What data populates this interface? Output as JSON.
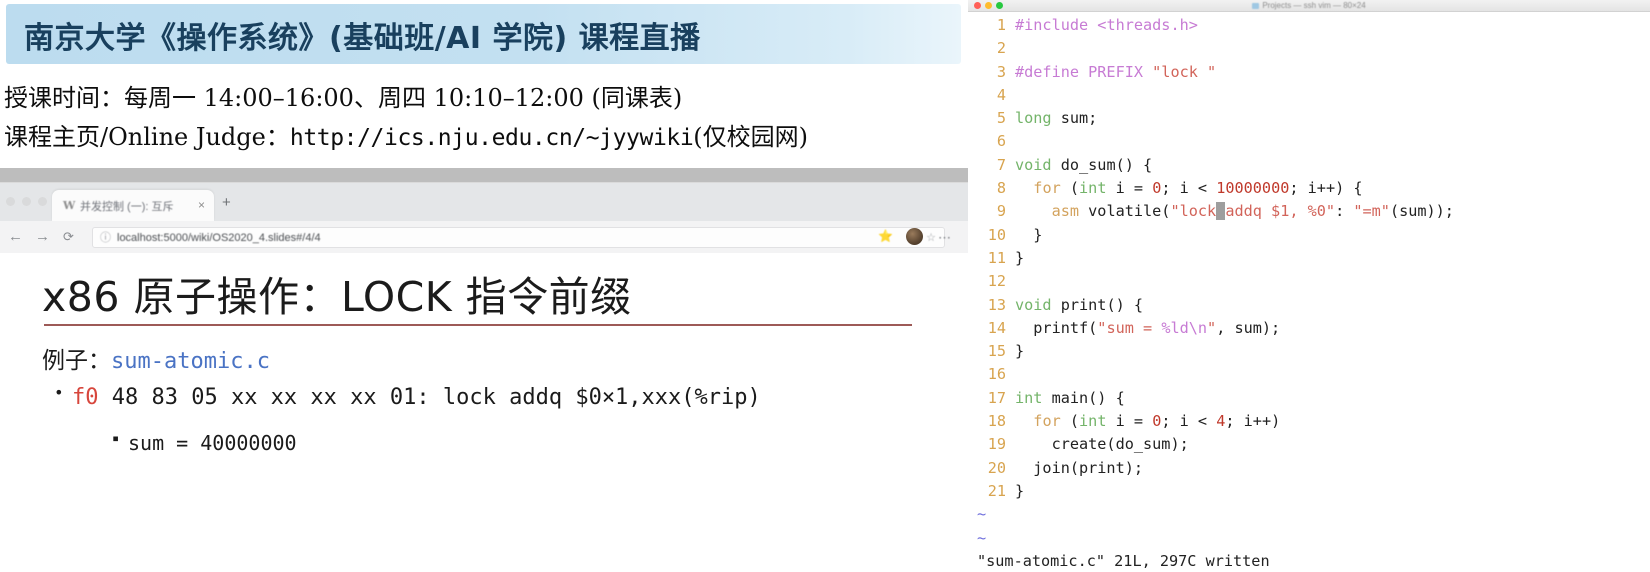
{
  "banner": {
    "title": "南京大学《操作系统》(基础班/AI 学院) 课程直播",
    "course_time": "授课时间：每周一 14:00–16:00、周四 10:10–12:00 (同课表)",
    "course_home_label": "课程主页/Online Judge：",
    "course_home_url": "http://ics.nju.edu.cn/~jyywiki",
    "course_home_note": "(仅校园网)"
  },
  "browser": {
    "tab": {
      "favicon_letter": "W",
      "title": "并发控制 (一): 互斥",
      "close_label": "×",
      "new_tab_label": "+"
    },
    "nav": {
      "back_icon": "←",
      "forward_icon": "→",
      "reload_icon": "⟳",
      "info_icon": "ⓘ",
      "url": "localhost:5000/wiki/OS2020_4.slides#/4/4",
      "bookmark_star": "☆",
      "collections_star": "⭐",
      "menu_dots": "⋯"
    }
  },
  "slide": {
    "title": "x86 原子操作：LOCK 指令前缀",
    "example_label": "例子：",
    "example_file": "sum-atomic.c",
    "bullet_hex_prefix": "f0",
    "bullet_hex_rest": " 48 83 05 xx xx xx xx 01: lock addq $0×1,xxx(%rip)",
    "bullet_sum": "sum = 40000000"
  },
  "terminal": {
    "title": "Projects — ssh vim — 80×24",
    "traffic_lights": [
      "#ff5f57",
      "#febc2e",
      "#28c840"
    ],
    "status_line": "\"sum-atomic.c\" 21L, 297C written",
    "tilde_marker": "~",
    "lines": [
      {
        "n": "1",
        "tokens": [
          {
            "t": "#include ",
            "c": "c-pre"
          },
          {
            "t": "<threads.h>",
            "c": "c-pre"
          }
        ]
      },
      {
        "n": "2",
        "tokens": []
      },
      {
        "n": "3",
        "tokens": [
          {
            "t": "#define PREFIX ",
            "c": "c-pre"
          },
          {
            "t": "\"lock \"",
            "c": "c-str"
          }
        ]
      },
      {
        "n": "4",
        "tokens": []
      },
      {
        "n": "5",
        "tokens": [
          {
            "t": "long",
            "c": "c-type"
          },
          {
            "t": " sum;",
            "c": "c-plain"
          }
        ]
      },
      {
        "n": "6",
        "tokens": []
      },
      {
        "n": "7",
        "tokens": [
          {
            "t": "void",
            "c": "c-type"
          },
          {
            "t": " do_sum() {",
            "c": "c-plain"
          }
        ]
      },
      {
        "n": "8",
        "tokens": [
          {
            "t": "  ",
            "c": "c-plain"
          },
          {
            "t": "for",
            "c": "c-stmt"
          },
          {
            "t": " (",
            "c": "c-plain"
          },
          {
            "t": "int",
            "c": "c-type"
          },
          {
            "t": " i = ",
            "c": "c-plain"
          },
          {
            "t": "0",
            "c": "c-num"
          },
          {
            "t": "; i < ",
            "c": "c-plain"
          },
          {
            "t": "10000000",
            "c": "c-num"
          },
          {
            "t": "; i++) {",
            "c": "c-plain"
          }
        ]
      },
      {
        "n": "9",
        "tokens": [
          {
            "t": "    ",
            "c": "c-plain"
          },
          {
            "t": "asm",
            "c": "c-stmt"
          },
          {
            "t": " volatile(",
            "c": "c-plain"
          },
          {
            "t": "\"lock",
            "c": "c-str"
          },
          {
            "t": " ",
            "c": "cursor"
          },
          {
            "t": "addq $1, %0\"",
            "c": "c-str"
          },
          {
            "t": ": ",
            "c": "c-plain"
          },
          {
            "t": "\"=m\"",
            "c": "c-str"
          },
          {
            "t": "(sum));",
            "c": "c-plain"
          }
        ]
      },
      {
        "n": "10",
        "tokens": [
          {
            "t": "  }",
            "c": "c-plain"
          }
        ]
      },
      {
        "n": "11",
        "tokens": [
          {
            "t": "}",
            "c": "c-plain"
          }
        ]
      },
      {
        "n": "12",
        "tokens": []
      },
      {
        "n": "13",
        "tokens": [
          {
            "t": "void",
            "c": "c-type"
          },
          {
            "t": " print() {",
            "c": "c-plain"
          }
        ]
      },
      {
        "n": "14",
        "tokens": [
          {
            "t": "  printf(",
            "c": "c-plain"
          },
          {
            "t": "\"sum = ",
            "c": "c-str"
          },
          {
            "t": "%ld\\n",
            "c": "c-fmt"
          },
          {
            "t": "\"",
            "c": "c-str"
          },
          {
            "t": ", sum);",
            "c": "c-plain"
          }
        ]
      },
      {
        "n": "15",
        "tokens": [
          {
            "t": "}",
            "c": "c-plain"
          }
        ]
      },
      {
        "n": "16",
        "tokens": []
      },
      {
        "n": "17",
        "tokens": [
          {
            "t": "int",
            "c": "c-type"
          },
          {
            "t": " main() {",
            "c": "c-plain"
          }
        ]
      },
      {
        "n": "18",
        "tokens": [
          {
            "t": "  ",
            "c": "c-plain"
          },
          {
            "t": "for",
            "c": "c-stmt"
          },
          {
            "t": " (",
            "c": "c-plain"
          },
          {
            "t": "int",
            "c": "c-type"
          },
          {
            "t": " i = ",
            "c": "c-plain"
          },
          {
            "t": "0",
            "c": "c-num"
          },
          {
            "t": "; i < ",
            "c": "c-plain"
          },
          {
            "t": "4",
            "c": "c-num"
          },
          {
            "t": "; i++)",
            "c": "c-plain"
          }
        ]
      },
      {
        "n": "19",
        "tokens": [
          {
            "t": "    create(do_sum);",
            "c": "c-plain"
          }
        ]
      },
      {
        "n": "20",
        "tokens": [
          {
            "t": "  join(print);",
            "c": "c-plain"
          }
        ]
      },
      {
        "n": "21",
        "tokens": [
          {
            "t": "}",
            "c": "c-plain"
          }
        ]
      }
    ]
  }
}
